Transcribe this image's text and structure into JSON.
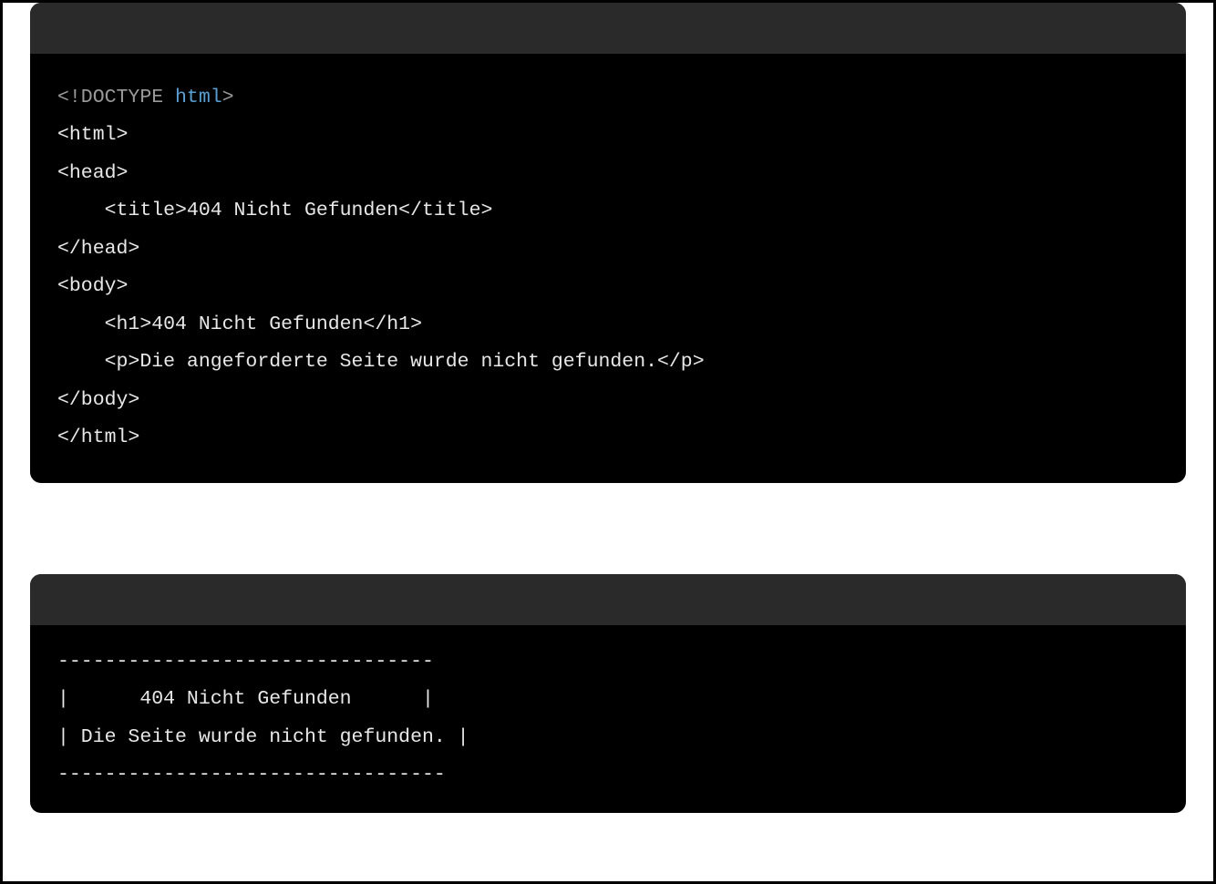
{
  "block1": {
    "line1_doctype_open": "<!DOCTYPE ",
    "line1_html_kw": "html",
    "line1_doctype_close": ">",
    "line2": "<html>",
    "line3": "<head>",
    "line4": "    <title>404 Nicht Gefunden</title>",
    "line5": "</head>",
    "line6": "<body>",
    "line7": "    <h1>404 Nicht Gefunden</h1>",
    "line8": "    <p>Die angeforderte Seite wurde nicht gefunden.</p>",
    "line9": "</body>",
    "line10": "</html>"
  },
  "block2": {
    "line1": "--------------------------------",
    "line2": "|      404 Nicht Gefunden      |",
    "line3": "| Die Seite wurde nicht gefunden. |",
    "line4": "---------------------------------"
  }
}
